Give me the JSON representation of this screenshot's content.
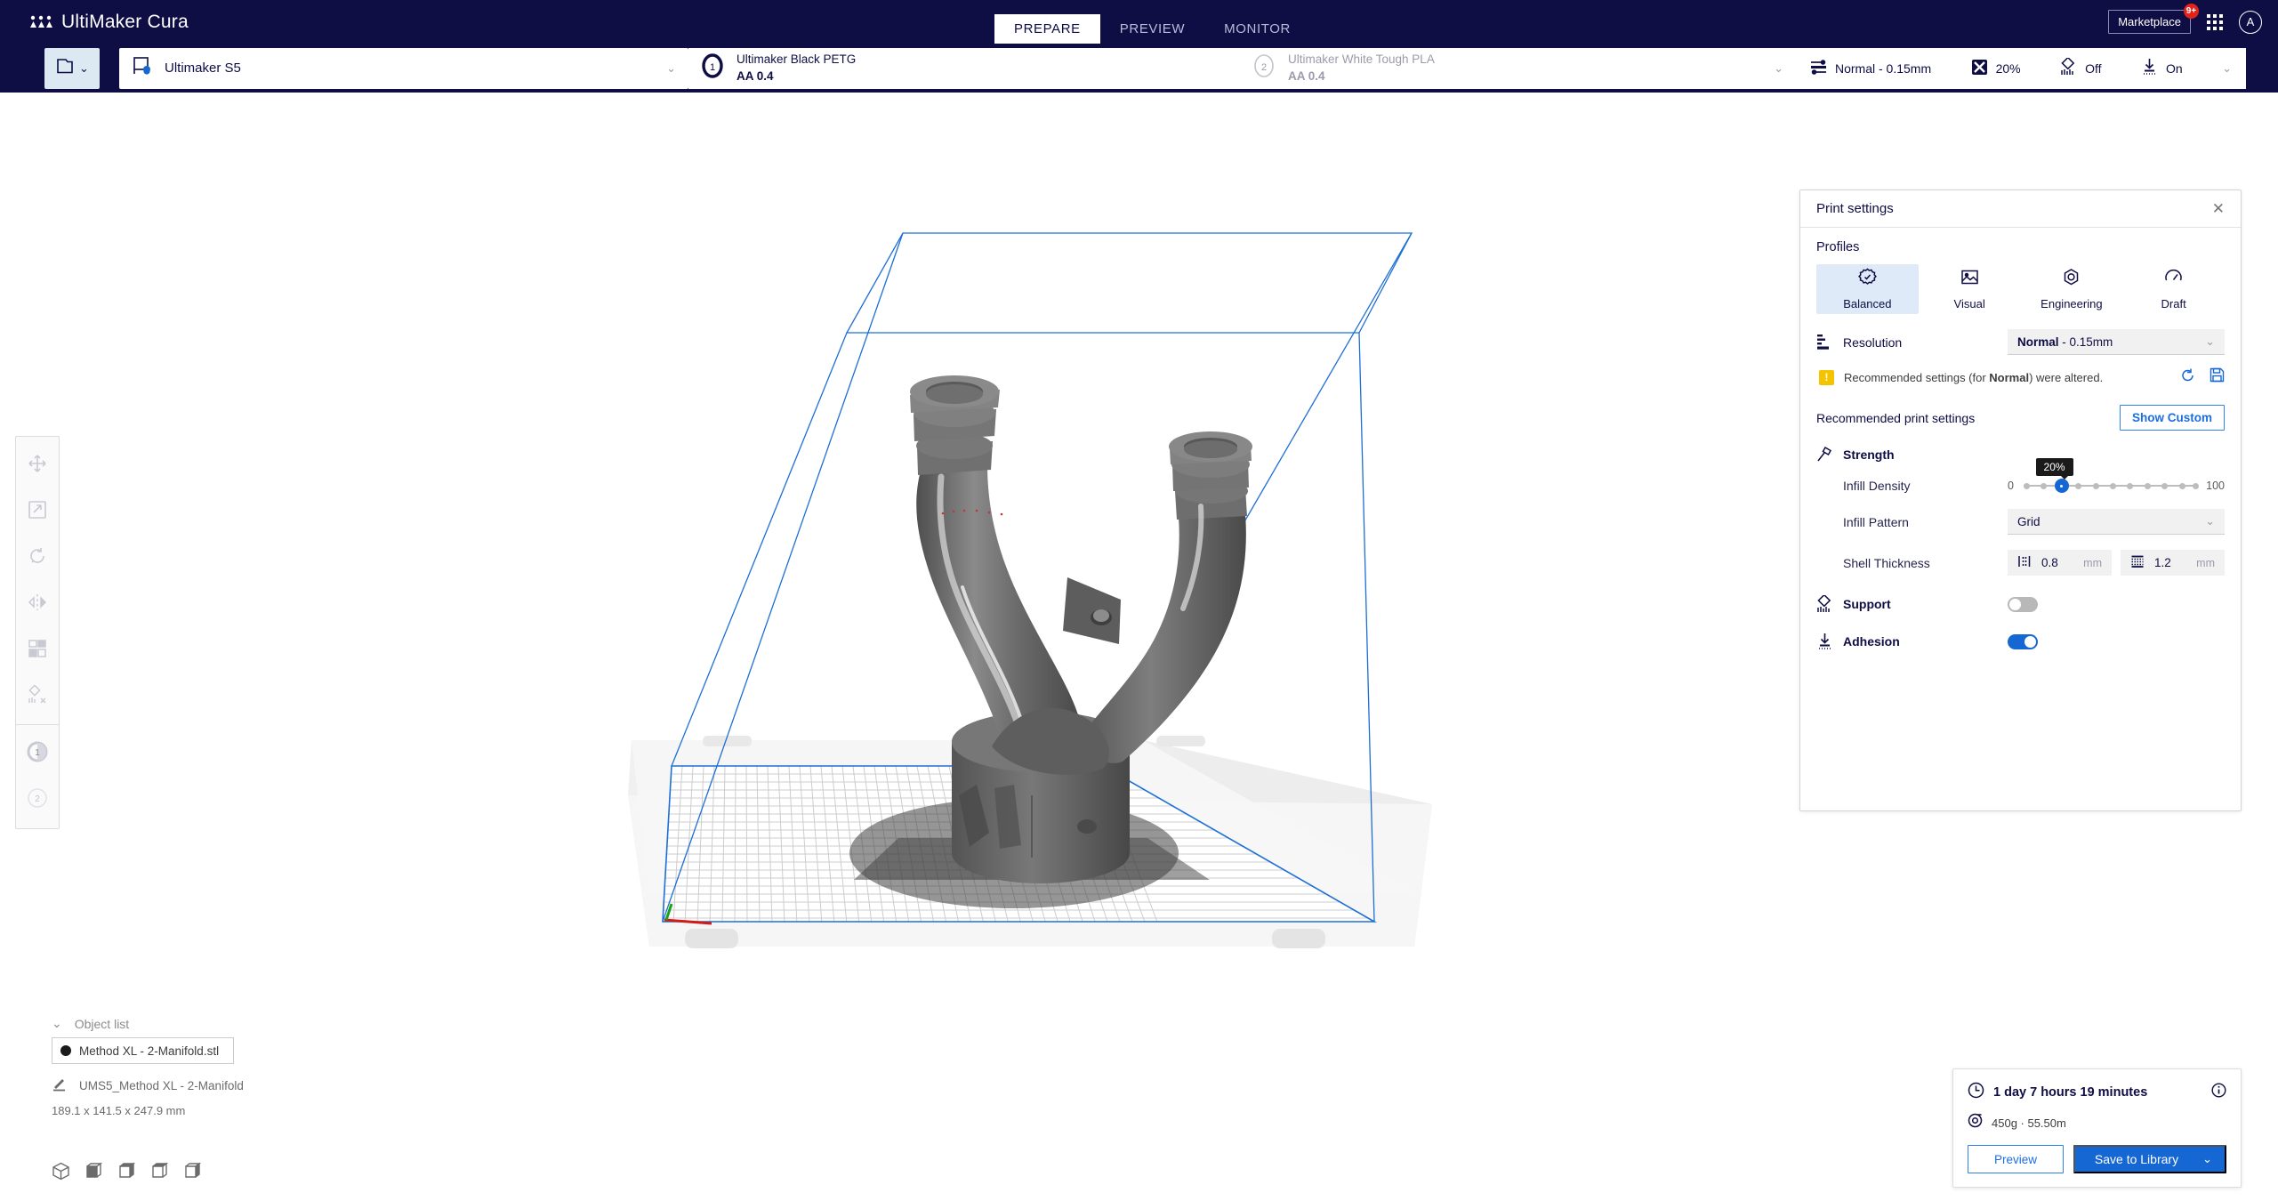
{
  "app": {
    "name": "UltiMaker Cura",
    "logo_icon": "ultimaker-logo-icon"
  },
  "topbar": {
    "tabs": [
      {
        "label": "PREPARE",
        "active": true
      },
      {
        "label": "PREVIEW",
        "active": false
      },
      {
        "label": "MONITOR",
        "active": false
      }
    ],
    "marketplace_label": "Marketplace",
    "marketplace_badge": "9+",
    "apps_icon": "grid-apps-icon",
    "account_initial": "A"
  },
  "machinebar": {
    "open_file_icon": "folder-open-icon",
    "printer": {
      "icon": "printer-icon",
      "name": "Ultimaker S5"
    },
    "extruders": [
      {
        "number": "1",
        "material": "Ultimaker Black PETG",
        "core": "AA 0.4",
        "enabled": true
      },
      {
        "number": "2",
        "material": "Ultimaker White Tough PLA",
        "core": "AA 0.4",
        "enabled": false
      }
    ],
    "settings_summary": {
      "profile_icon": "sliders-icon",
      "profile": "Normal - 0.15mm",
      "infill_icon": "infill-grid-icon",
      "infill": "20%",
      "support_icon": "support-icon",
      "support": "Off",
      "adhesion_icon": "adhesion-icon",
      "adhesion": "On"
    }
  },
  "left_tools": [
    {
      "name": "move-tool",
      "icon": "move-arrows-icon"
    },
    {
      "name": "scale-tool",
      "icon": "scale-icon"
    },
    {
      "name": "rotate-tool",
      "icon": "rotate-icon"
    },
    {
      "name": "mirror-tool",
      "icon": "mirror-icon"
    },
    {
      "name": "per-model-settings-tool",
      "icon": "per-model-settings-icon"
    },
    {
      "name": "support-blocker-tool",
      "icon": "support-blocker-icon"
    }
  ],
  "extruder_tools": [
    {
      "name": "extruder-1-button",
      "label": "1",
      "enabled": true
    },
    {
      "name": "extruder-2-button",
      "label": "2",
      "enabled": false
    }
  ],
  "object_list": {
    "header": "Object list",
    "chevron_icon": "chevron-down-icon",
    "items": [
      {
        "name": "Method XL - 2-Manifold.stl",
        "color_swatch": "#1a1a1a"
      }
    ],
    "profile_icon": "pencil-icon",
    "profile_name": "UMS5_Method XL - 2-Manifold",
    "dimensions": "189.1 x 141.5 x 247.9 mm"
  },
  "view_modes": [
    {
      "name": "view-3d-icon",
      "active": false
    },
    {
      "name": "view-front-icon",
      "active": false
    },
    {
      "name": "view-top-icon",
      "active": false
    },
    {
      "name": "view-left-icon",
      "active": false
    },
    {
      "name": "view-right-icon",
      "active": false
    }
  ],
  "print_settings": {
    "title": "Print settings",
    "close_icon": "close-icon",
    "profiles_label": "Profiles",
    "profiles": [
      {
        "label": "Balanced",
        "icon": "balanced-gear-icon",
        "active": true
      },
      {
        "label": "Visual",
        "icon": "visual-image-icon",
        "active": false
      },
      {
        "label": "Engineering",
        "icon": "engineering-nut-icon",
        "active": false
      },
      {
        "label": "Draft",
        "icon": "draft-gauge-icon",
        "active": false
      }
    ],
    "resolution": {
      "icon": "layer-height-icon",
      "label": "Resolution",
      "value_bold": "Normal",
      "value_rest": " - 0.15mm",
      "chevron_icon": "chevron-down-icon"
    },
    "warning": {
      "icon": "warning-icon",
      "text_a": "Recommended settings (for ",
      "text_b": "Normal",
      "text_c": ") were altered.",
      "reset_icon": "reset-arrow-icon",
      "save_icon": "save-disk-icon"
    },
    "recommended_label": "Recommended print settings",
    "show_custom_label": "Show Custom",
    "strength": {
      "icon": "strength-hammer-icon",
      "label": "Strength",
      "infill_density": {
        "label": "Infill Density",
        "min": "0",
        "max": "100",
        "value": 20,
        "tooltip": "20%",
        "ticks": 11
      },
      "infill_pattern": {
        "label": "Infill Pattern",
        "value": "Grid",
        "chevron_icon": "chevron-down-icon"
      },
      "shell_thickness": {
        "label": "Shell Thickness",
        "wall_icon": "wall-thickness-icon",
        "wall_value": "0.8",
        "wall_unit": "mm",
        "top_icon": "top-bottom-thickness-icon",
        "top_value": "1.2",
        "top_unit": "mm"
      }
    },
    "support": {
      "icon": "support-icon",
      "label": "Support",
      "enabled": false
    },
    "adhesion": {
      "icon": "adhesion-icon",
      "label": "Adhesion",
      "enabled": true
    }
  },
  "job_card": {
    "time_icon": "clock-icon",
    "time": "1 day 7 hours 19 minutes",
    "info_icon": "info-icon",
    "material_icon": "spool-icon",
    "material": "450g · 55.50m",
    "preview_label": "Preview",
    "save_label": "Save to Library",
    "save_chevron_icon": "chevron-down-icon"
  },
  "colors": {
    "brand_navy": "#0e0d44",
    "accent_blue": "#1567d3",
    "badge_red": "#e2231a",
    "warning_yellow": "#f5c400",
    "buildplate_outline": "#1d6fd6"
  }
}
